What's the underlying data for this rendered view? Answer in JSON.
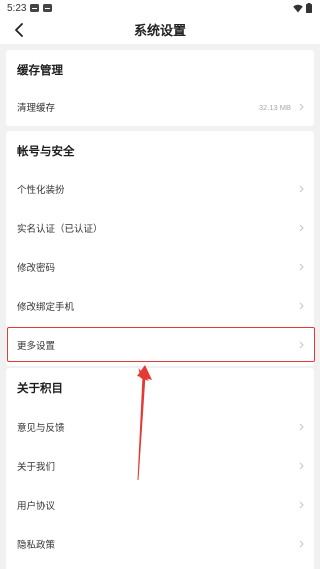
{
  "status_bar": {
    "time": "5:23"
  },
  "header": {
    "title": "系统设置"
  },
  "cache_section": {
    "title": "缓存管理",
    "clear_cache": {
      "label": "清理缓存",
      "value": "32.13 MB"
    }
  },
  "account_section": {
    "title": "帐号与安全",
    "items": [
      {
        "label": "个性化装扮"
      },
      {
        "label": "实名认证（已认证）"
      },
      {
        "label": "修改密码"
      },
      {
        "label": "修改绑定手机"
      },
      {
        "label": "更多设置"
      }
    ]
  },
  "about_section": {
    "title": "关于积目",
    "items": [
      {
        "label": "意见与反馈"
      },
      {
        "label": "关于我们"
      },
      {
        "label": "用户协议"
      },
      {
        "label": "隐私政策"
      }
    ]
  },
  "colors": {
    "highlight": "#e53935",
    "background": "#f1f1f1"
  },
  "icons": {
    "back": "back-arrow-icon",
    "chevron": "chevron-right-icon"
  }
}
